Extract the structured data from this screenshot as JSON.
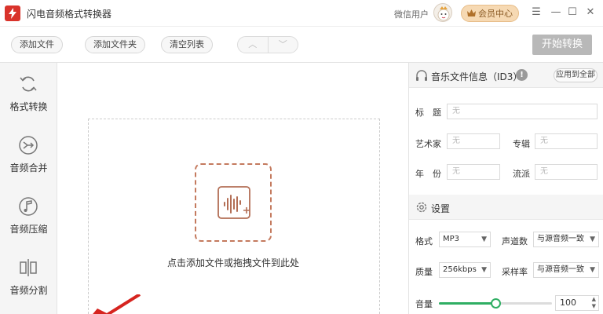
{
  "app": {
    "title": "闪电音频格式转换器"
  },
  "titlebar": {
    "user_name": "微信用户",
    "member_label": "会员中心",
    "menu_icon": "menu-icon",
    "minimize_icon": "minimize-icon",
    "close_icon": "close-icon"
  },
  "toolbar": {
    "add_file": "添加文件",
    "add_folder": "添加文件夹",
    "clear_list": "清空列表",
    "start": "开始转换"
  },
  "sidebar": {
    "items": [
      {
        "label": "格式转换",
        "icon": "refresh-icon"
      },
      {
        "label": "音频合并",
        "icon": "merge-icon"
      },
      {
        "label": "音频压缩",
        "icon": "music-note-icon"
      },
      {
        "label": "音频分割",
        "icon": "split-icon"
      }
    ]
  },
  "dropzone": {
    "hint": "点击添加文件或拖拽文件到此处"
  },
  "music_info": {
    "title": "音乐文件信息（ID3）",
    "apply_all": "应用到全部",
    "fields": {
      "title_label": "标　题",
      "title_value": "无",
      "artist_label": "艺术家",
      "artist_value": "无",
      "album_label": "专辑",
      "album_value": "无",
      "year_label": "年　份",
      "year_value": "无",
      "genre_label": "流派",
      "genre_value": "无"
    }
  },
  "settings": {
    "title": "设置",
    "format_label": "格式",
    "format_value": "MP3",
    "channels_label": "声道数",
    "channels_value": "与源音频一致",
    "quality_label": "质量",
    "quality_value": "256kbps",
    "samplerate_label": "采样率",
    "samplerate_value": "与源音频一致",
    "volume_label": "音量",
    "volume_value": "100",
    "volume_fraction": 0.5
  },
  "colors": {
    "accent": "#2fae63",
    "brand": "#d9332b",
    "start_button": "#b8b8b8"
  }
}
